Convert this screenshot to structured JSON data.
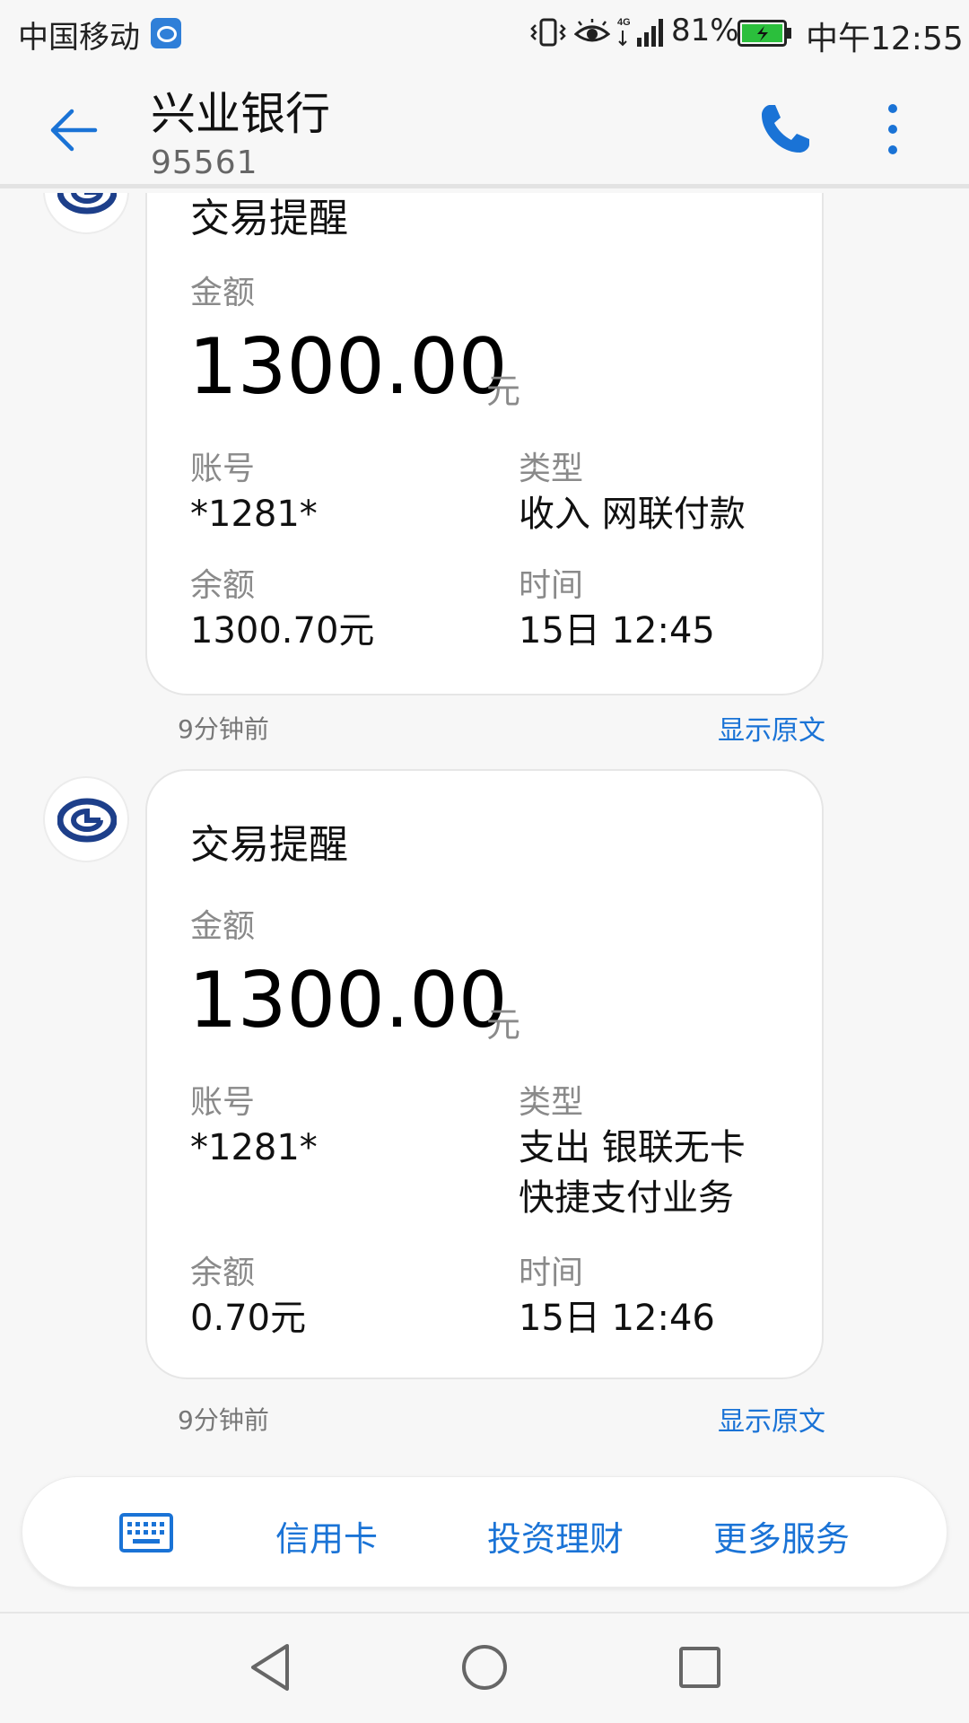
{
  "status_bar": {
    "carrier": "中国移动",
    "battery_percent": "81%",
    "clock": "中午12:55",
    "icons": [
      "carrier-app-icon",
      "vibrate-icon",
      "eye-icon",
      "signal-4g-icon",
      "battery-charging-icon"
    ]
  },
  "header": {
    "title": "兴业银行",
    "subtitle": "95561",
    "icons": [
      "back-arrow-icon",
      "phone-icon",
      "more-vertical-icon"
    ]
  },
  "messages": [
    {
      "title": "交易提醒",
      "amount_label": "金额",
      "amount": "1300.00",
      "amount_unit": "元",
      "account_label": "账号",
      "account": "*1281*",
      "type_label": "类型",
      "type_lines": [
        "收入 网联付款"
      ],
      "balance_label": "余额",
      "balance": "1300.70元",
      "time_label": "时间",
      "time": "15日 12:45",
      "received_ago": "9分钟前",
      "show_original": "显示原文"
    },
    {
      "title": "交易提醒",
      "amount_label": "金额",
      "amount": "1300.00",
      "amount_unit": "元",
      "account_label": "账号",
      "account": "*1281*",
      "type_label": "类型",
      "type_lines": [
        "支出 银联无卡",
        "快捷支付业务"
      ],
      "balance_label": "余额",
      "balance": "0.70元",
      "time_label": "时间",
      "time": "15日 12:46",
      "received_ago": "9分钟前",
      "show_original": "显示原文"
    }
  ],
  "action_bar": {
    "items": [
      "信用卡",
      "投资理财",
      "更多服务"
    ],
    "keyboard_icon": "keyboard-icon"
  },
  "nav_bar": {
    "icons": [
      "nav-back-icon",
      "nav-home-icon",
      "nav-recent-icon"
    ]
  },
  "colors": {
    "accent": "#1a73d6",
    "background": "#f7f7f7",
    "bank_logo": "#1d3f8a"
  }
}
